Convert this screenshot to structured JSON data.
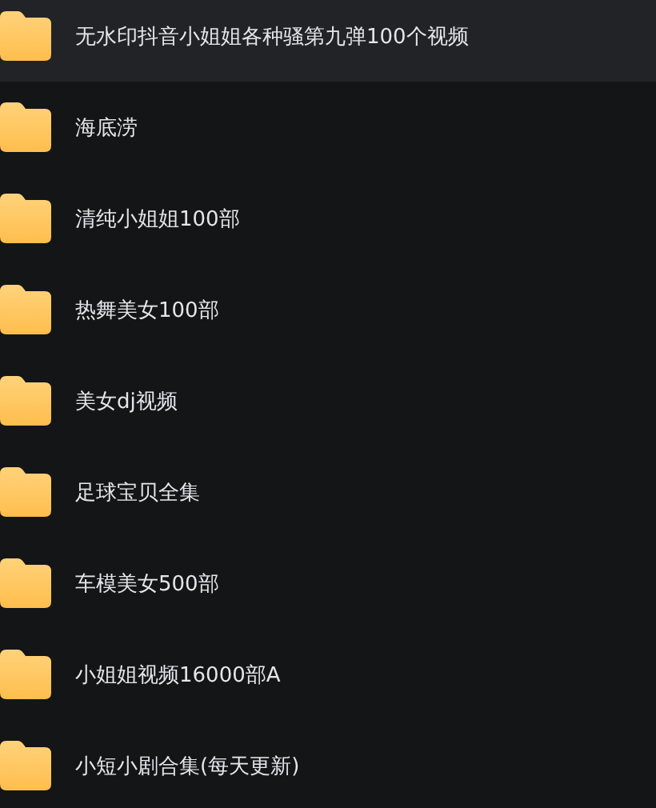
{
  "folders": [
    {
      "name": "无水印抖音小姐姐各种骚第九弹100个视频",
      "selected": true
    },
    {
      "name": "海底涝",
      "selected": false
    },
    {
      "name": "清纯小姐姐100部",
      "selected": false
    },
    {
      "name": "热舞美女100部",
      "selected": false
    },
    {
      "name": "美女dj视频",
      "selected": false
    },
    {
      "name": "足球宝贝全集",
      "selected": false
    },
    {
      "name": "车模美女500部",
      "selected": false
    },
    {
      "name": "小姐姐视频16000部A",
      "selected": false
    },
    {
      "name": "小短小剧合集(每天更新)",
      "selected": false
    }
  ]
}
